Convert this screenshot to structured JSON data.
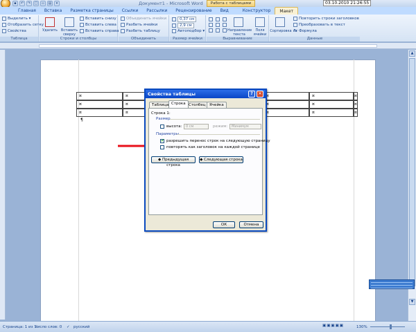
{
  "title_bar": {
    "doc_title": "Документ1 - Microsoft Word",
    "context_tab_header": "Работа с таблицами",
    "clock": "03.10.2010 21:26:55"
  },
  "tabs": [
    "Главная",
    "Вставка",
    "Разметка страницы",
    "Ссылки",
    "Рассылки",
    "Рецензирование",
    "Вид",
    "Конструктор",
    "Макет"
  ],
  "active_tab": "Макет",
  "ribbon": {
    "groups": {
      "table": "Таблица",
      "rows_cols": "Строки и столбцы",
      "merge": "Объединить",
      "cell_size": "Размер ячейки",
      "alignment": "Выравнивание",
      "data": "Данные"
    },
    "table": {
      "select": "Выделить ▾",
      "gridlines": "Отобразить сетку",
      "properties": "Свойства"
    },
    "rows_cols": {
      "delete": "Удалить",
      "insert_above": "Вставить сверху",
      "insert_below": "Вставить снизу",
      "insert_left": "Вставить слева",
      "insert_right": "Вставить справа"
    },
    "merge": {
      "merge_cells": "Объединить ячейки",
      "split_cells": "Разбить ячейки",
      "split_table": "Разбить таблицу"
    },
    "cell_size": {
      "height": "0,37 см",
      "width": "2,9 см",
      "autofit": "Автоподбор ▾"
    },
    "alignment": {
      "text_direction": "Направление текста",
      "cell_margins": "Поля ячейки"
    },
    "data": {
      "sort": "Сортировка",
      "repeat_header": "Повторить строки заголовков",
      "convert": "Преобразовать в текст",
      "formula": "Формула"
    }
  },
  "document": {
    "cell_mark": "¤",
    "paragraph_mark": "¶"
  },
  "dialog": {
    "title": "Свойства таблицы",
    "help": "?",
    "close": "✕",
    "tabs": [
      "Таблица",
      "Строка",
      "Столбец",
      "Ячейка"
    ],
    "active_tab": "Строка",
    "row_label": "Строка 1:",
    "size_section": "Размер",
    "height_label": "высота:",
    "height_value": "0 см",
    "mode_label": "режим:",
    "mode_value": "Минимум",
    "params_section": "Параметры",
    "allow_break_label": "разрешить перенос строк на следующую страницу",
    "allow_break_checked": true,
    "repeat_header_label": "повторять как заголовок на каждой странице",
    "repeat_header_checked": false,
    "prev_row": "Предыдущая строка",
    "next_row": "Следующая строка",
    "ok": "ОК",
    "cancel": "Отмена"
  },
  "status_bar": {
    "page": "Страница: 1 из 1",
    "words": "Число слов: 0",
    "language": "русский",
    "zoom": "130%"
  },
  "colors": {
    "arrow": "#e8101a",
    "dialog_title": "#0a46c6",
    "context_tab": "#f4d27a"
  }
}
